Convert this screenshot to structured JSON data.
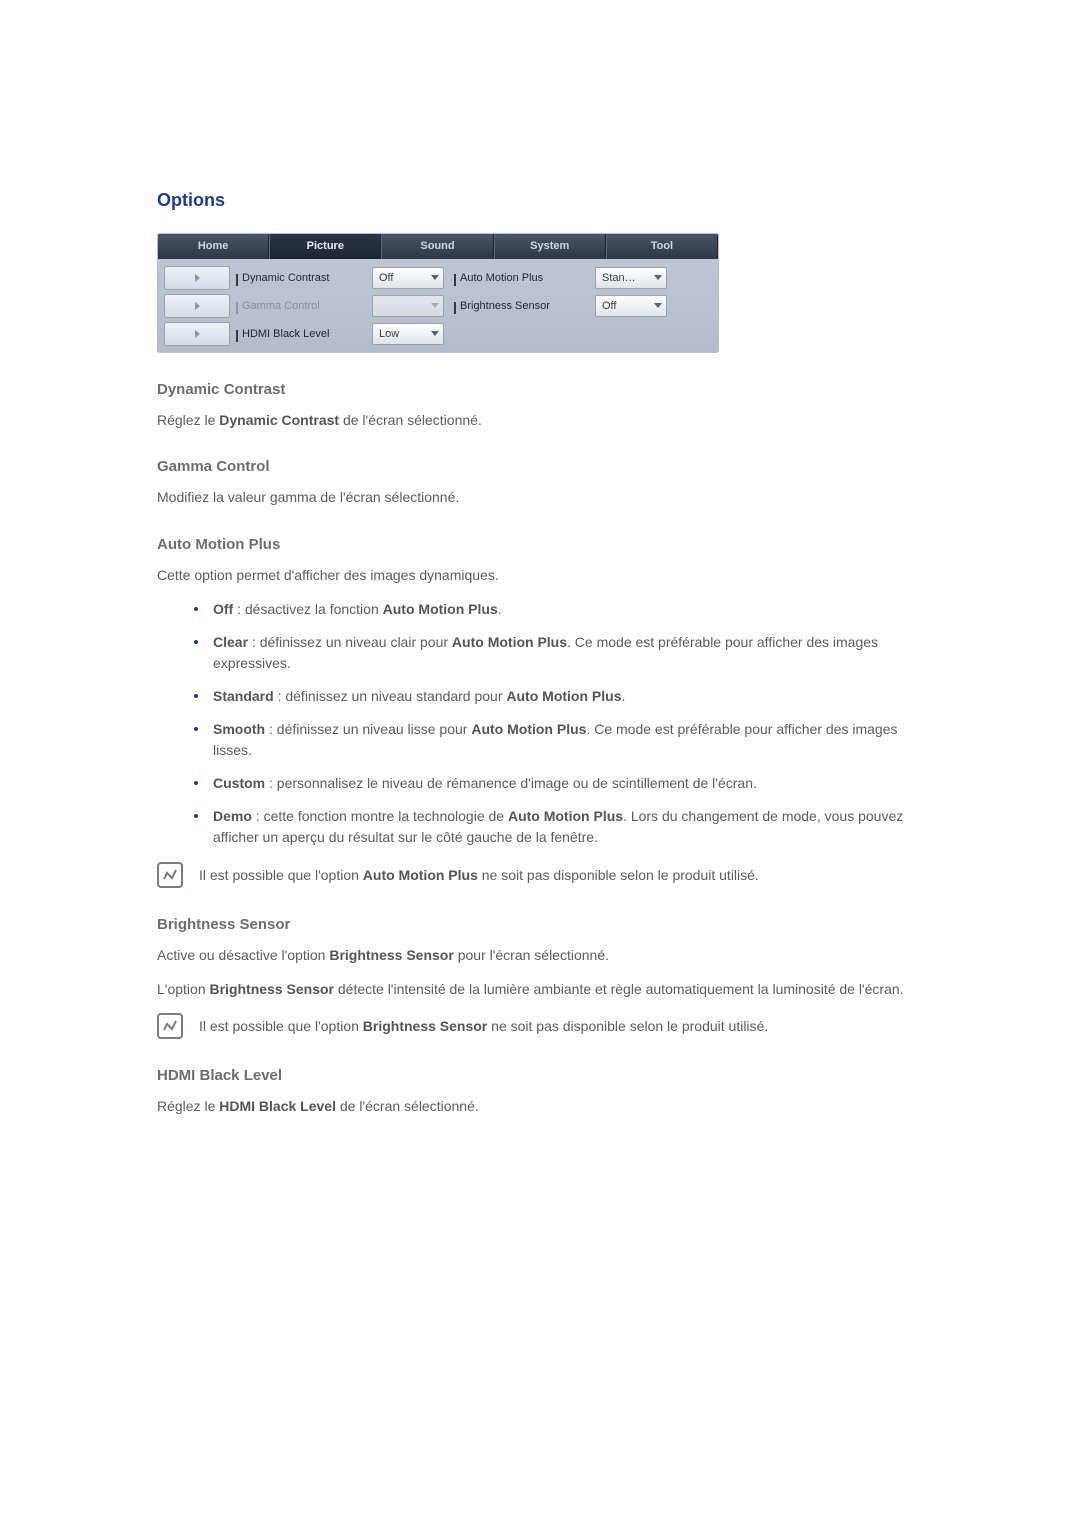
{
  "title": "Options",
  "panel": {
    "tabs": [
      "Home",
      "Picture",
      "Sound",
      "System",
      "Tool"
    ],
    "active_tab_index": 1,
    "rows": [
      {
        "label_a": "Dynamic Contrast",
        "value_a": "Off",
        "label_b": "Auto Motion Plus",
        "value_b": "Stan…"
      },
      {
        "label_a": "Gamma Control",
        "value_a": "",
        "label_b": "Brightness Sensor",
        "value_b": "Off",
        "disabled": true
      },
      {
        "label_a": "HDMI Black Level",
        "value_a": "Low"
      }
    ]
  },
  "dynamic_contrast": {
    "heading": "Dynamic Contrast",
    "text_pre": "Réglez le ",
    "text_bold": "Dynamic Contrast",
    "text_post": " de l'écran sélectionné."
  },
  "gamma_control": {
    "heading": "Gamma Control",
    "text": "Modifiez la valeur gamma de l'écran sélectionné."
  },
  "auto_motion_plus": {
    "heading": "Auto Motion Plus",
    "text": "Cette option permet d'afficher des images dynamiques.",
    "items": [
      {
        "bold": "Off",
        "rest": " : désactivez la fonction ",
        "bold2": "Auto Motion Plus",
        "rest2": "."
      },
      {
        "bold": "Clear",
        "rest": " : définissez un niveau clair pour ",
        "bold2": "Auto Motion Plus",
        "rest2": ". Ce mode est préférable pour afficher des images expressives."
      },
      {
        "bold": "Standard",
        "rest": " : définissez un niveau standard pour ",
        "bold2": "Auto Motion Plus",
        "rest2": "."
      },
      {
        "bold": "Smooth",
        "rest": " : définissez un niveau lisse pour ",
        "bold2": "Auto Motion Plus",
        "rest2": ". Ce mode est préférable pour afficher des images lisses."
      },
      {
        "bold": "Custom",
        "rest": " : personnalisez le niveau de rémanence d'image ou de scintillement de l'écran."
      },
      {
        "bold": "Demo",
        "rest": " : cette fonction montre la technologie de ",
        "bold2": "Auto Motion Plus",
        "rest2": ". Lors du changement de mode, vous pouvez afficher un aperçu du résultat sur le côté gauche de la fenêtre."
      }
    ],
    "note_pre": "Il est possible que l'option ",
    "note_bold": "Auto Motion Plus",
    "note_post": " ne soit pas disponible selon le produit utilisé."
  },
  "brightness_sensor": {
    "heading": "Brightness Sensor",
    "p1_pre": "Active ou désactive l'option ",
    "p1_bold": "Brightness Sensor",
    "p1_post": " pour l'écran sélectionné.",
    "p2_pre": "L'option ",
    "p2_bold": "Brightness Sensor",
    "p2_post": " détecte l'intensité de la lumière ambiante et règle automatiquement la luminosité de l'écran.",
    "note_pre": "Il est possible que l'option ",
    "note_bold": "Brightness Sensor",
    "note_post": " ne soit pas disponible selon le produit utilisé."
  },
  "hdmi_black_level": {
    "heading": "HDMI Black Level",
    "text_pre": "Réglez le ",
    "text_bold": "HDMI Black Level",
    "text_post": " de l'écran sélectionné."
  }
}
